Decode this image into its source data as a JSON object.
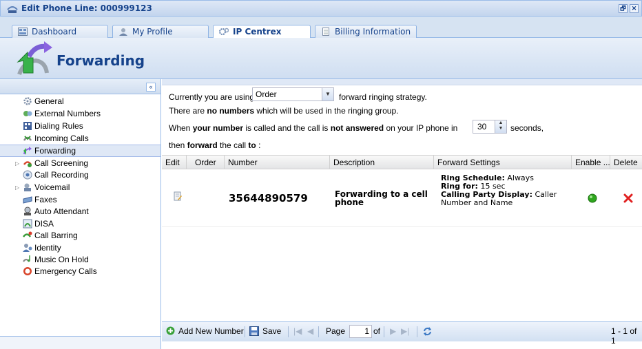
{
  "window": {
    "title": "Edit Phone Line: 000999123",
    "restore_label": "🗗",
    "close_label": "✕"
  },
  "tabs": [
    {
      "label": "Dashboard",
      "icon": "dashboard-icon"
    },
    {
      "label": "My Profile",
      "icon": "user-icon"
    },
    {
      "label": "IP Centrex",
      "icon": "gears-icon",
      "active": true
    },
    {
      "label": "Billing Information",
      "icon": "document-icon"
    }
  ],
  "header": {
    "title": "Forwarding"
  },
  "sidebar": {
    "collapse_label": "«",
    "items": [
      {
        "label": "General",
        "icon": "gear-icon"
      },
      {
        "label": "External Numbers",
        "icon": "external-numbers-icon"
      },
      {
        "label": "Dialing Rules",
        "icon": "dialing-rules-icon"
      },
      {
        "label": "Incoming Calls",
        "icon": "incoming-calls-icon"
      },
      {
        "label": "Forwarding",
        "icon": "forwarding-icon",
        "selected": true
      },
      {
        "label": "Call Screening",
        "icon": "call-screening-icon",
        "expandable": true
      },
      {
        "label": "Call Recording",
        "icon": "call-recording-icon"
      },
      {
        "label": "Voicemail",
        "icon": "voicemail-icon",
        "expandable": true
      },
      {
        "label": "Faxes",
        "icon": "fax-icon"
      },
      {
        "label": "Auto Attendant",
        "icon": "auto-attendant-icon"
      },
      {
        "label": "DISA",
        "icon": "disa-icon"
      },
      {
        "label": "Call Barring",
        "icon": "call-barring-icon"
      },
      {
        "label": "Identity",
        "icon": "identity-icon"
      },
      {
        "label": "Music On Hold",
        "icon": "music-icon"
      },
      {
        "label": "Emergency Calls",
        "icon": "emergency-icon"
      }
    ]
  },
  "main": {
    "strategy_prefix": "Currently you are using",
    "strategy_value": "Order",
    "strategy_suffix": "forward ringing strategy.",
    "ring_group_pre": "There are ",
    "ring_group_bold": "no numbers",
    "ring_group_post": " which will be used in the ringing group.",
    "when_pre": "When ",
    "when_bold1": "your number",
    "when_mid": " is called and the call is ",
    "when_bold2": "not answered",
    "when_post": " on your IP phone in",
    "seconds_value": "30",
    "seconds_label": "seconds,",
    "then_pre": "then ",
    "then_bold1": "forward",
    "then_mid": " the call ",
    "then_bold2": "to",
    "then_post": " :"
  },
  "grid": {
    "columns": [
      "Edit",
      "Order",
      "Number",
      "Description",
      "Forward Settings",
      "Enable ...",
      "Delete"
    ],
    "rows": [
      {
        "number": "35644890579",
        "description": "Forwarding to a cell phone",
        "ring_schedule_label": "Ring Schedule:",
        "ring_schedule_value": "Always",
        "ring_for_label": "Ring for:",
        "ring_for_value": "15 sec",
        "cpd_label": "Calling Party Display:",
        "cpd_value": "Caller Number and Name",
        "enabled": true
      }
    ]
  },
  "toolbar": {
    "add_label": "Add New Number",
    "save_label": "Save",
    "page_label": "Page",
    "page_value": "1",
    "of_label": "of",
    "range_label": "1 - 1 of 1"
  },
  "colors": {
    "accent": "#15428b",
    "border": "#99bbe8",
    "enabled": "#2fa61e",
    "delete": "#e02020"
  }
}
